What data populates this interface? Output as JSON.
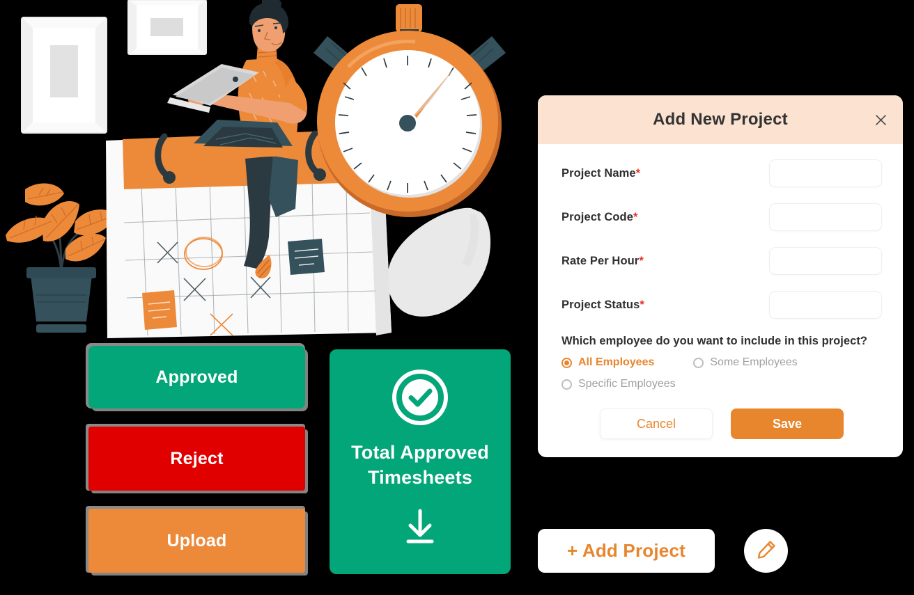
{
  "modal": {
    "title": "Add New Project",
    "close_icon": "close-icon",
    "fields": [
      {
        "label": "Project Name",
        "required": "*",
        "value": "",
        "placeholder": ""
      },
      {
        "label": "Project Code",
        "required": "*",
        "value": "",
        "placeholder": ""
      },
      {
        "label": "Rate Per Hour",
        "required": "*",
        "value": "",
        "placeholder": ""
      },
      {
        "label": "Project Status",
        "required": "*",
        "value": "",
        "placeholder": ""
      }
    ],
    "question": "Which employee do you want to include in this project?",
    "radio_options": [
      {
        "label": "All Employees",
        "selected": true
      },
      {
        "label": "Some Employees",
        "selected": false
      },
      {
        "label": "Specific Employees",
        "selected": false
      }
    ],
    "cancel_label": "Cancel",
    "save_label": "Save",
    "header_bg": "#FCE2D0",
    "accent": "#E8862E",
    "required_color": "#E8302A"
  },
  "actions": {
    "approved_label": "Approved",
    "reject_label": "Reject",
    "upload_label": "Upload",
    "approved_color": "#03A678",
    "reject_color": "#E00000",
    "upload_color": "#ED8A3A"
  },
  "stat_card": {
    "title": "Total Approved Timesheets",
    "check_icon": "check-circle-icon",
    "download_icon": "download-icon",
    "bg_color": "#03A678"
  },
  "bottom_bar": {
    "add_project_label": "+ Add Project",
    "edit_icon": "pencil-edit-icon"
  },
  "illustration": {
    "name": "time-tracking-illustration",
    "elements": [
      "wall-picture-frame",
      "wall-landscape-frame",
      "potted-plant",
      "calendar",
      "stopwatch",
      "person-with-laptop",
      "decorative-blob"
    ],
    "palette": {
      "orange": "#ED8A3A",
      "orange_dark": "#C96A28",
      "dark": "#2F3E46",
      "light_gray": "#E8E8E8",
      "white": "#FFFFFF"
    }
  }
}
